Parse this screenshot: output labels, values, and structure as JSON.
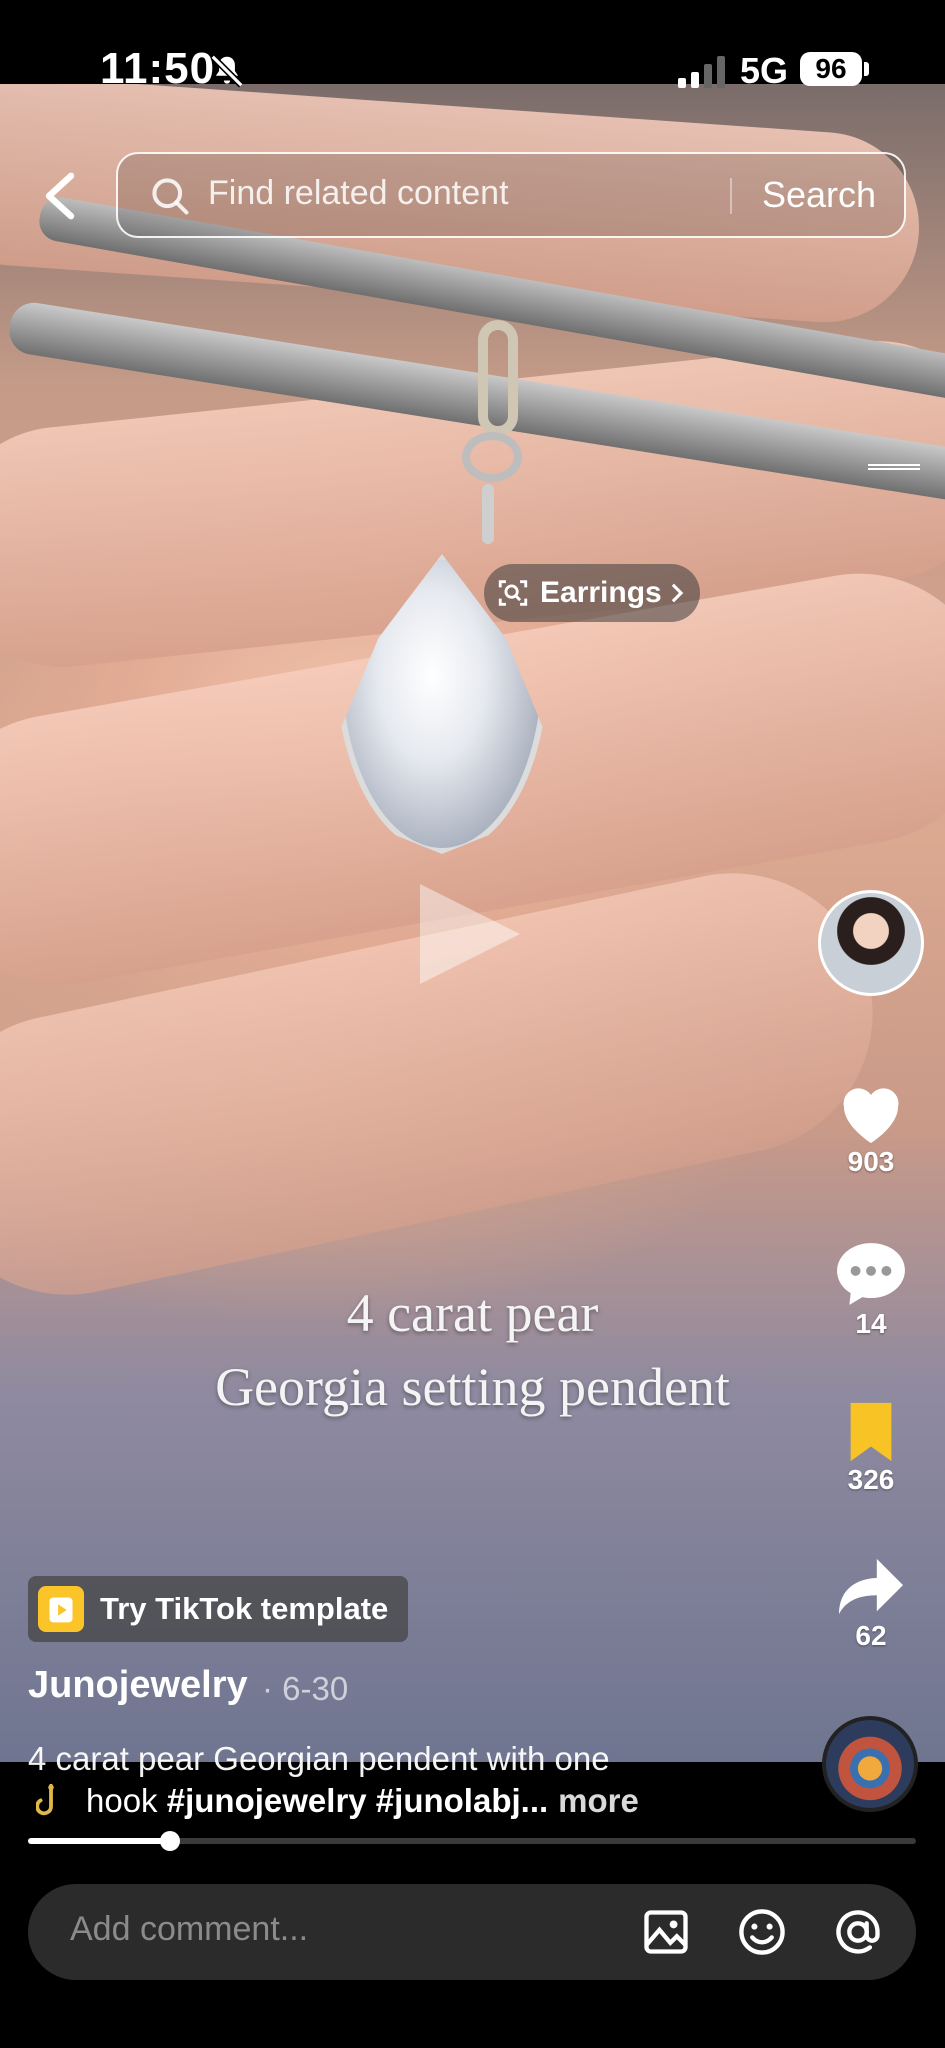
{
  "status_bar": {
    "time": "11:50",
    "network": "5G",
    "battery": "96"
  },
  "search": {
    "placeholder": "Find related content",
    "button_label": "Search"
  },
  "product_chip": {
    "label": "Earrings"
  },
  "video": {
    "overlay_line1": "4 carat pear",
    "overlay_line2": "Georgia setting pendent"
  },
  "actions": {
    "likes": "903",
    "comments": "14",
    "saves": "326",
    "shares": "62",
    "save_color": "#f7c325"
  },
  "post": {
    "template_label": "Try TikTok template",
    "username": "Junojewelry",
    "date": " · 6-30",
    "caption_line1": "4 carat pear Georgian pendent with one",
    "caption_line2_text": "hook ",
    "caption_line2_tags": "#junojewelry #junolabj...",
    "more_label": "more",
    "progress": 0.16
  },
  "comment": {
    "placeholder": "Add comment..."
  }
}
